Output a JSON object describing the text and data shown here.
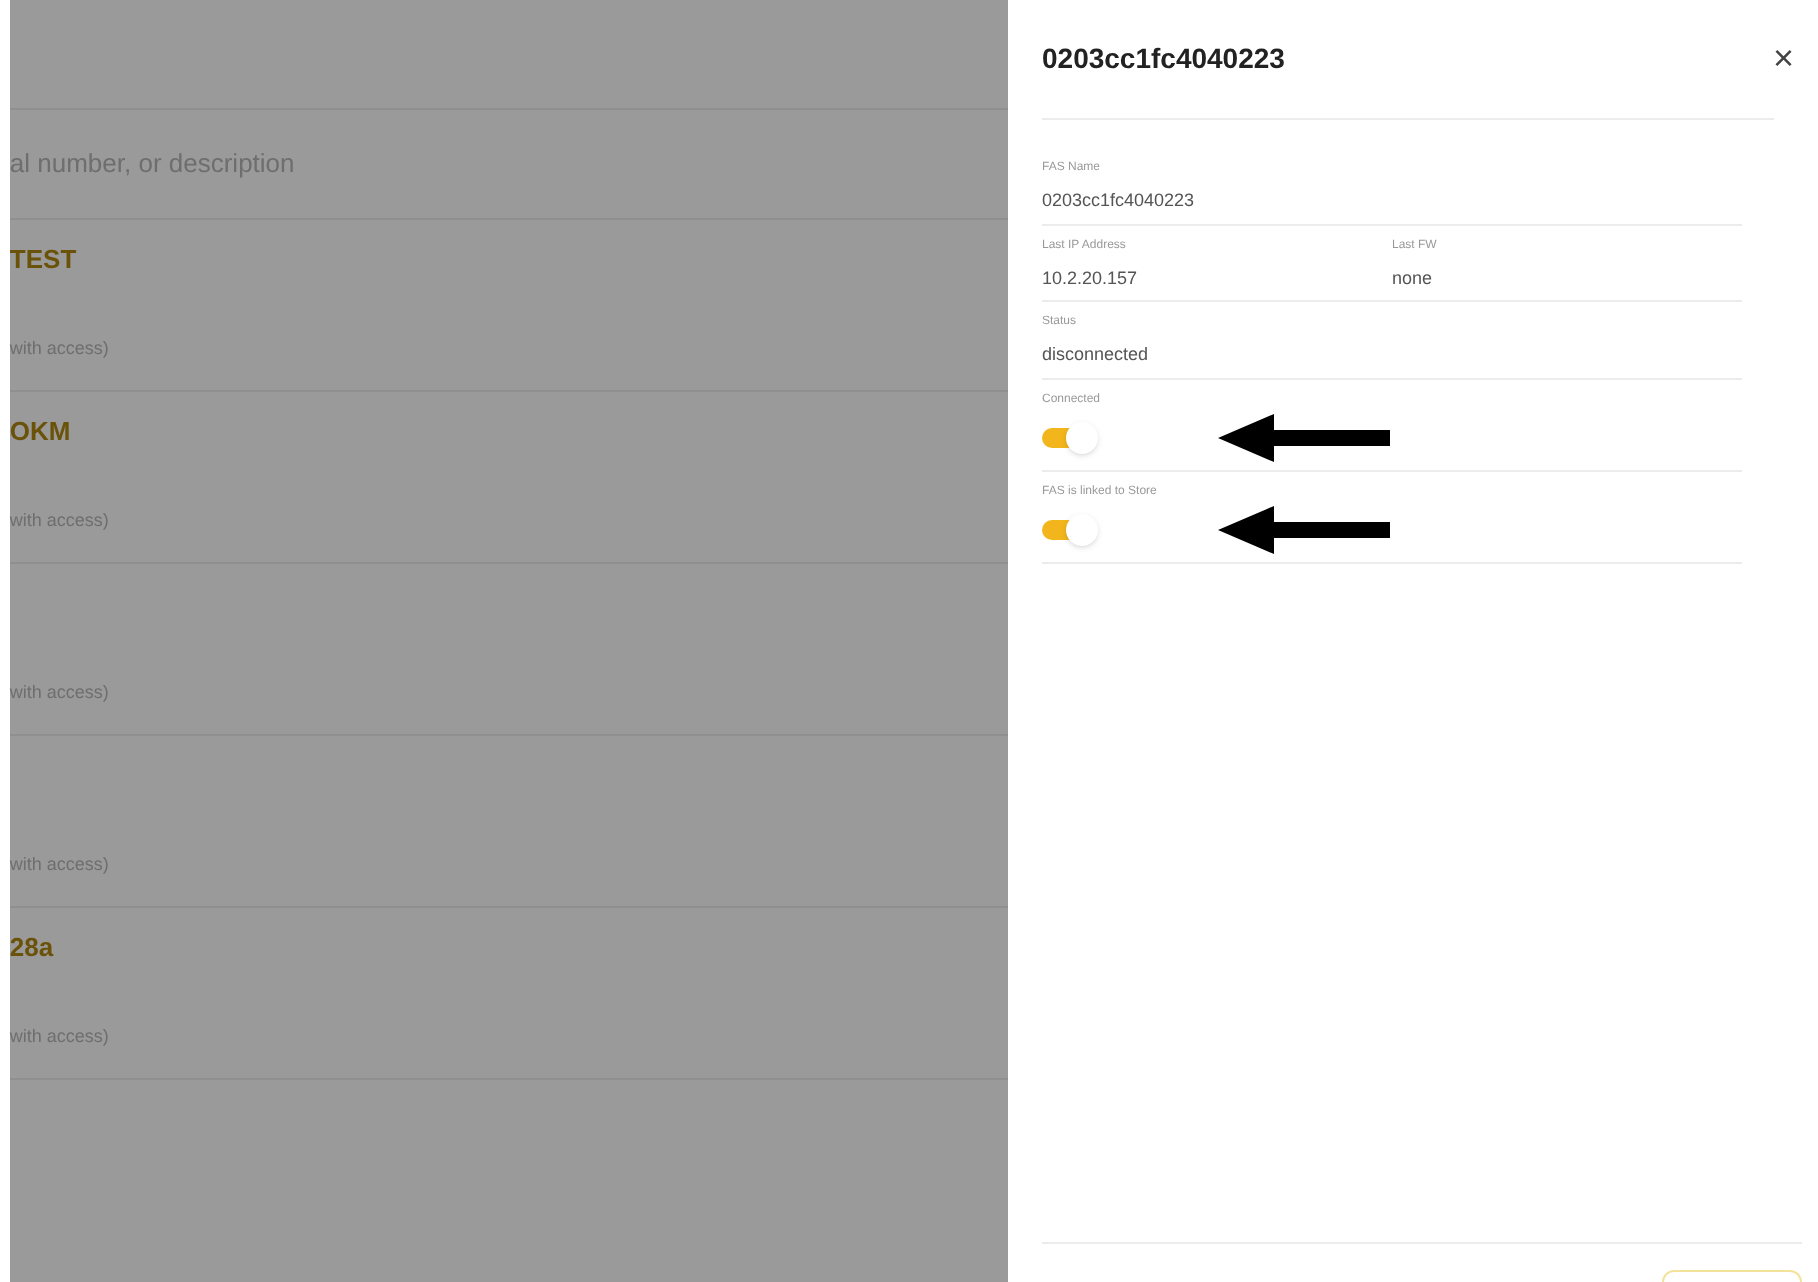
{
  "background_list": {
    "search": {
      "placeholder": "al number, or description"
    },
    "items": [
      {
        "title": "TEST",
        "subtitle": "with access)"
      },
      {
        "title": "OKM",
        "subtitle": "with access)"
      },
      {
        "subtitle": "with access)"
      },
      {
        "subtitle": "with access)"
      },
      {
        "title": "28a",
        "subtitle": "with access)"
      }
    ]
  },
  "drawer": {
    "title": "0203cc1fc4040223",
    "close": "×",
    "fields": [
      {
        "kind": "text",
        "label": "FAS Name",
        "value": "0203cc1fc4040223"
      },
      {
        "kind": "pair",
        "items": [
          {
            "label": "Last IP Address",
            "value": "10.2.20.157"
          },
          {
            "label": "Last FW",
            "value": "none"
          }
        ]
      },
      {
        "kind": "text",
        "label": "Status",
        "value": "disconnected"
      },
      {
        "kind": "toggle",
        "label": "Connected",
        "on": true
      },
      {
        "kind": "toggle",
        "label": "FAS is linked to Store",
        "on": true
      }
    ]
  }
}
